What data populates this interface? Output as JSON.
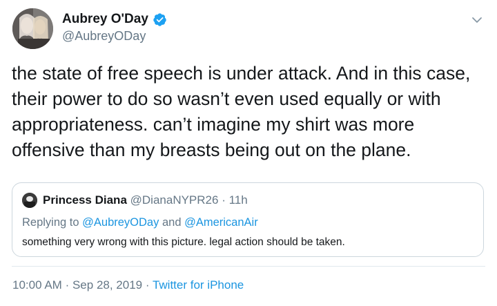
{
  "author": {
    "display_name": "Aubrey O'Day",
    "handle": "@AubreyODay",
    "verified": true
  },
  "tweet": {
    "text": "the state of free speech is under attack. And in this case, their power to do so wasn’t even used equally or with appropriateness. can’t imagine my shirt was more offensive than my breasts being out on the plane."
  },
  "quoted_tweet": {
    "display_name": "Princess Diana",
    "handle": "@DianaNYPR26",
    "separator": "·",
    "time": "11h",
    "replying_prefix": "Replying to",
    "reply_to_1": "@AubreyODay",
    "reply_and": "and",
    "reply_to_2": "@AmericanAir",
    "text": "something very wrong with this picture. legal action should be taken."
  },
  "meta": {
    "time": "10:00 AM",
    "separator": "·",
    "date": "Sep 28, 2019",
    "separator2": "·",
    "source": "Twitter for iPhone"
  },
  "colors": {
    "link": "#1b95e0",
    "verified_badge": "#1da1f2",
    "secondary_text": "#657786",
    "border": "#ccd6dd"
  },
  "icons": {
    "verified": "verified-badge-icon",
    "menu": "chevron-down-icon"
  }
}
